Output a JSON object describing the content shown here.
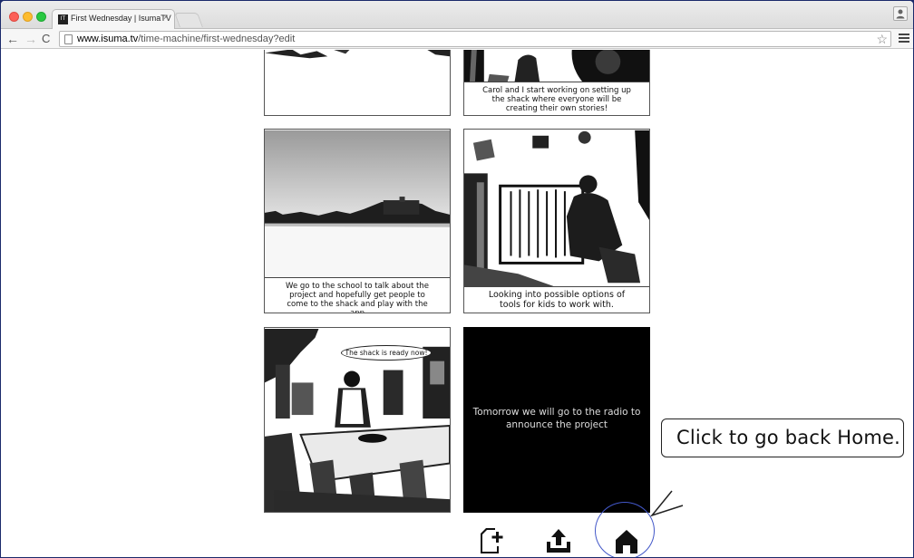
{
  "browser": {
    "tab_title": "First Wednesday | IsumaTV",
    "tab_favicon": "IsumaTV favicon",
    "tab_close": "×",
    "url_host": "www.isuma.tv",
    "url_path": "/time-machine/first-wednesday?edit",
    "nav": {
      "back": "←",
      "forward": "→",
      "reload": "C"
    },
    "star": "☆"
  },
  "story": {
    "panels": [
      {
        "id": "p1",
        "caption": "",
        "style": "light"
      },
      {
        "id": "p2",
        "caption": "Carol and I start working on setting up the shack where everyone will be creating their own stories!",
        "style": "light"
      },
      {
        "id": "p3",
        "caption": "We go to the school to talk about the project and hopefully get people to come to the shack and play with the app",
        "style": "light"
      },
      {
        "id": "p4",
        "caption": "Looking into possible options of tools for kids to work with.",
        "style": "light"
      },
      {
        "id": "p5",
        "caption": "",
        "speech_bubble": "The shack is ready now!",
        "style": "light"
      },
      {
        "id": "p6",
        "caption": "Tomorrow we will go to the radio to announce the project",
        "style": "dark"
      }
    ]
  },
  "actions": {
    "add_page": "add-page-icon",
    "upload": "upload-icon",
    "home": "home-icon"
  },
  "callout": {
    "text": "Click to go back Home."
  },
  "colors": {
    "highlight": "#4257c8",
    "dark_panel": "#000000"
  }
}
